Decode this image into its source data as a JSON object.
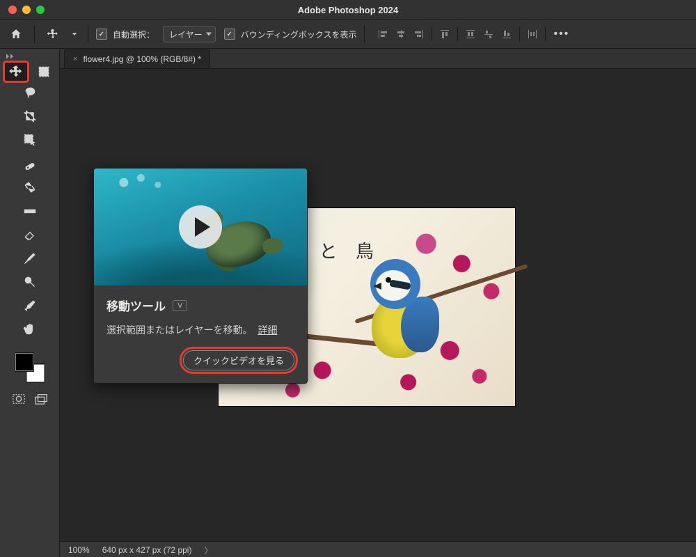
{
  "app": {
    "title": "Adobe Photoshop 2024"
  },
  "optbar": {
    "auto_select_label": "自動選択：",
    "auto_select_target": "レイヤー",
    "show_bbox_label": "バウンディングボックスを表示"
  },
  "tab": {
    "label": "flower4.jpg @ 100% (RGB/8#) *"
  },
  "artboard": {
    "overlay_text": "花 と 鳥"
  },
  "status": {
    "zoom": "100%",
    "dims": "640 px x 427 px (72 ppi)"
  },
  "tooltip": {
    "title": "移動ツール",
    "shortcut": "V",
    "desc_a": "選択範囲またはレイヤーを移動。",
    "desc_more": "詳細",
    "button": "クイックビデオを見る"
  },
  "tools": {
    "move": "move-tool",
    "marquee": "rectangular-marquee-tool",
    "lasso": "lasso-tool",
    "crop": "crop-tool",
    "wand": "object-selection-tool",
    "heal": "spot-healing-brush-tool",
    "remix": "content-aware-move-tool",
    "gradient": "gradient-tool",
    "eraser": "eraser-tool",
    "brush": "brush-tool",
    "dodge": "dodge-tool",
    "pen": "pen-tool",
    "hand": "hand-tool"
  }
}
